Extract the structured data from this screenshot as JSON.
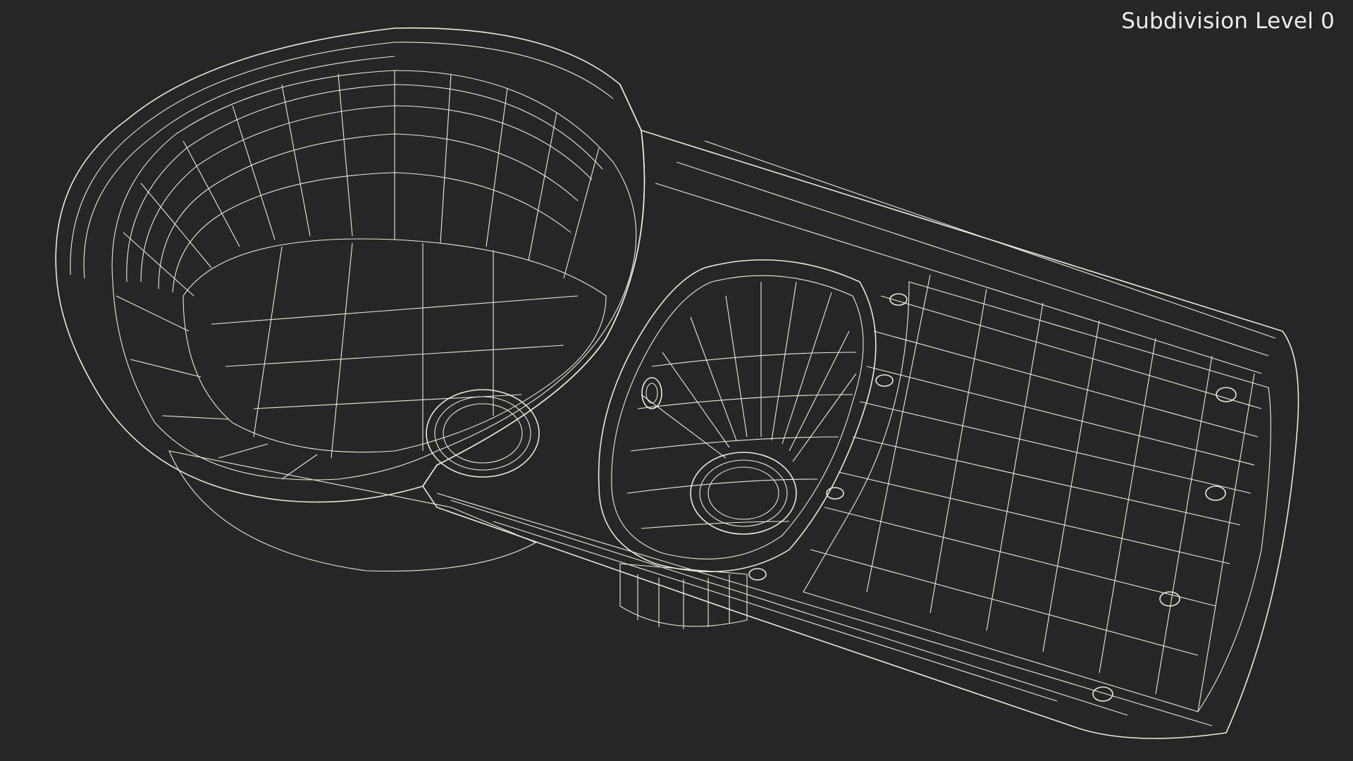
{
  "viewport": {
    "background_color": "#262626",
    "subdivision_label": "Subdivision Level 0"
  },
  "model": {
    "surface_color": "#7d7d72",
    "wire_color": "#ece9d8",
    "parts": [
      "large-round-bowl",
      "small-oval-bowl",
      "drainboard",
      "drain-hole-large",
      "drain-hole-small",
      "overflow-hole",
      "under-drain-pipe"
    ]
  }
}
